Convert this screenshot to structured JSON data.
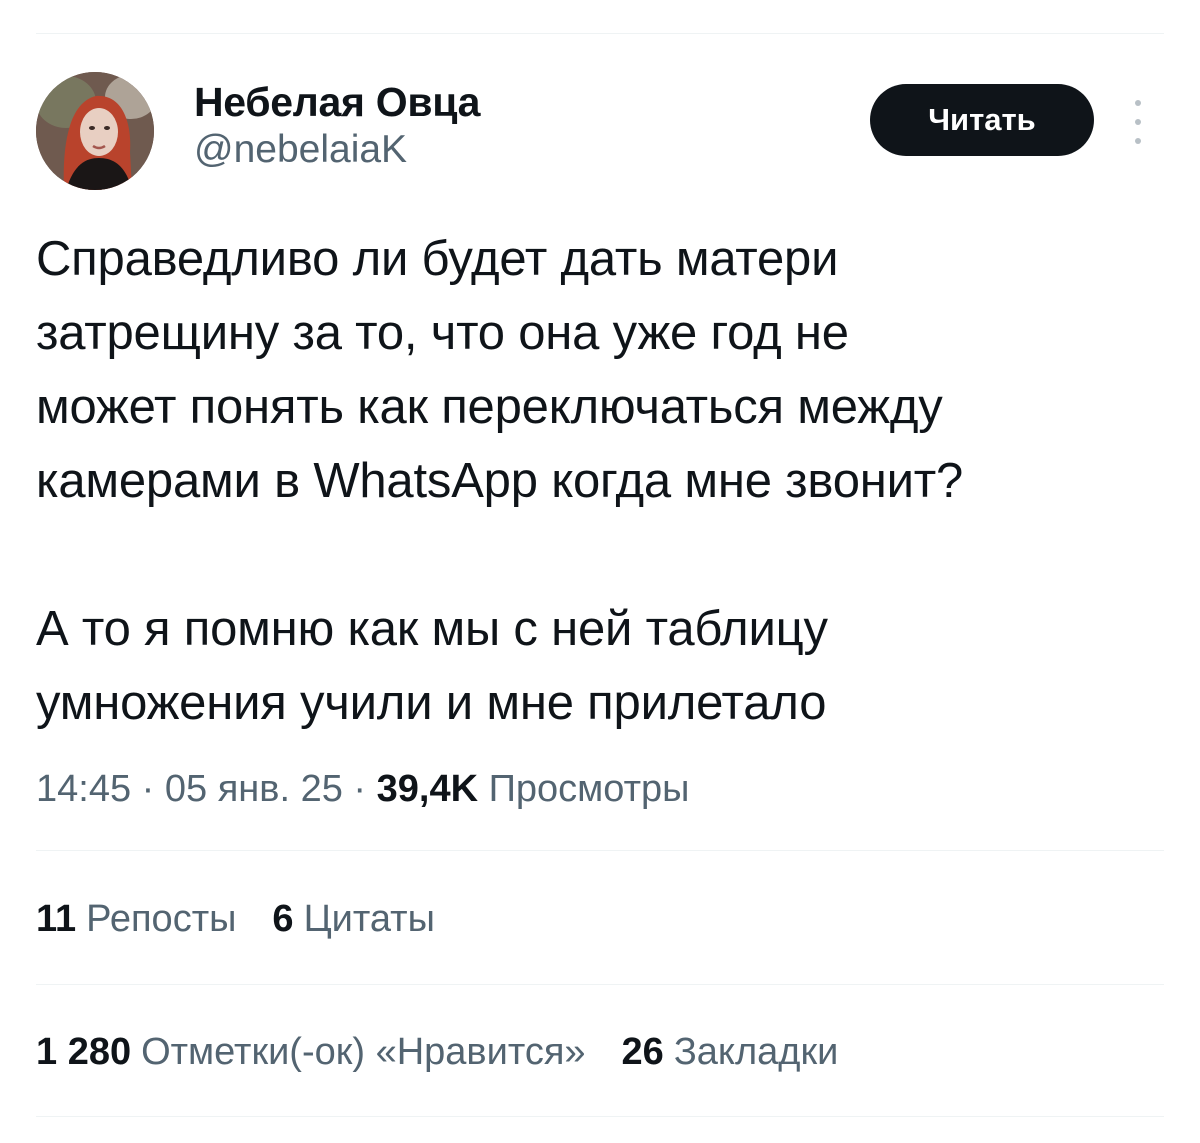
{
  "author": {
    "display_name": "Небелая Овца",
    "handle": "@nebelaiaK"
  },
  "follow_button": {
    "label": "Читать"
  },
  "more_icon": "more-vertical-icon",
  "tweet": {
    "text": "Справедливо ли будет дать матери\nзатрещину за то, что она уже год не\nможет понять как переключаться между\nкамерами в WhatsApp когда мне звонит?\n\nА то я помню как мы с ней таблицу\nумножения учили и мне прилетало"
  },
  "meta": {
    "time": "14:45",
    "separator": " · ",
    "date": "05 янв. 25",
    "views_count": "39,4K",
    "views_label": "Просмотры"
  },
  "stats_row_1": {
    "reposts_count": "11",
    "reposts_label": "Репосты",
    "quotes_count": "6",
    "quotes_label": "Цитаты"
  },
  "stats_row_2": {
    "likes_count": "1 280",
    "likes_label": "Отметки(-ок) «Нравится»",
    "bookmarks_count": "26",
    "bookmarks_label": "Закладки"
  },
  "colors": {
    "text_primary": "#0f1419",
    "text_secondary": "#536471",
    "divider": "#eff3f4",
    "button_bg": "#0f1419",
    "button_text": "#ffffff"
  }
}
